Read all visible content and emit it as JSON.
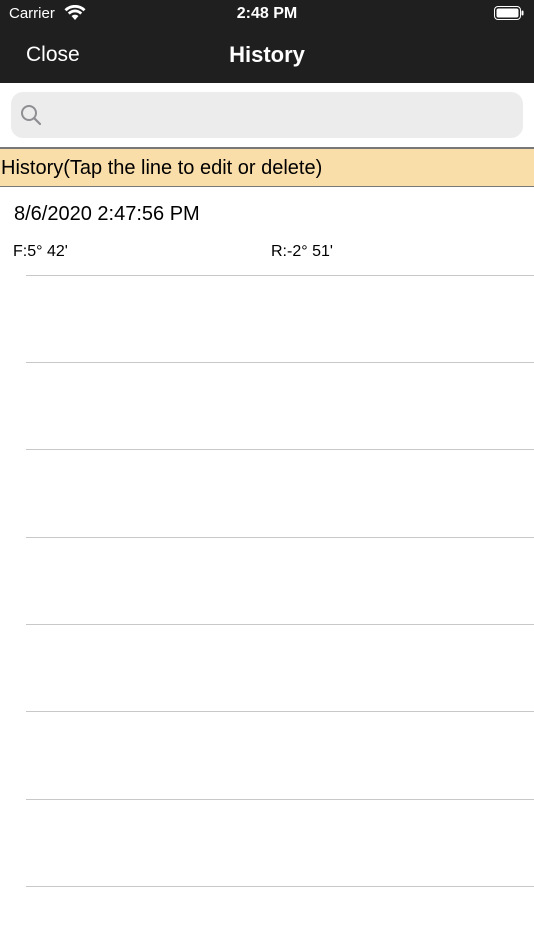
{
  "status_bar": {
    "carrier": "Carrier",
    "time": "2:48 PM"
  },
  "nav": {
    "close_label": "Close",
    "title": "History"
  },
  "search": {
    "placeholder": "",
    "value": ""
  },
  "section": {
    "header": "History(Tap the line to edit or delete)"
  },
  "entries": [
    {
      "datetime": "8/6/2020 2:47:56 PM",
      "front": "F:5° 42'",
      "rear": "R:-2° 51'"
    }
  ],
  "colors": {
    "nav_bg": "#1f1f1f",
    "section_bg": "#fadeaa",
    "search_bg": "#ececec"
  },
  "icons": {
    "wifi": "wifi-icon",
    "battery": "battery-icon",
    "search": "search-icon"
  }
}
